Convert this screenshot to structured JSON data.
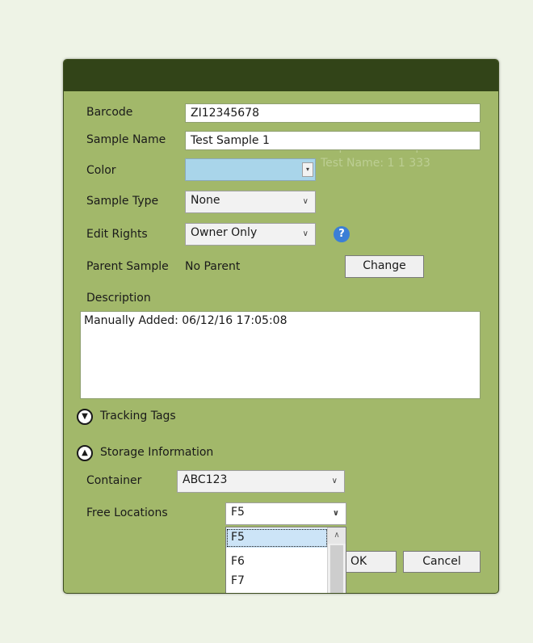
{
  "form": {
    "barcode_label": "Barcode",
    "barcode_value": "ZI12345678",
    "sample_name_label": "Sample Name",
    "sample_name_value": "Test Sample 1",
    "color_label": "Color",
    "color_value": "#a9d5ea",
    "sample_type_label": "Sample Type",
    "sample_type_value": "None",
    "edit_rights_label": "Edit Rights",
    "edit_rights_value": "Owner Only",
    "help_glyph": "?",
    "parent_sample_label": "Parent Sample",
    "parent_sample_value": "No Parent",
    "change_button": "Change",
    "description_label": "Description",
    "description_value": "Manually Added: 06/12/16 17:05:08"
  },
  "tracking": {
    "label": "Tracking Tags",
    "expanded": false
  },
  "storage": {
    "label": "Storage Information",
    "expanded": true,
    "container_label": "Container",
    "container_value": "ABC123",
    "free_locations_label": "Free Locations",
    "free_locations_value": "F5",
    "dropdown_options": [
      "F5",
      "F6",
      "F7"
    ],
    "dropdown_selected": "F5"
  },
  "buttons": {
    "ok": "OK",
    "cancel": "Cancel"
  },
  "background_ghost": {
    "lines": [
      "Emp Name: Sample First",
      "Test Name: 1 1 333"
    ]
  },
  "colors": {
    "title_bar": "#324418",
    "dialog_bg": "#a2b86a",
    "page_bg": "#eef3e6",
    "help_icon": "#3b7fd6"
  },
  "icons": {
    "combo_arrow": "chevron-down-icon",
    "help": "help-icon",
    "expander_collapsed": "chevron-down-circle-icon",
    "expander_expanded": "chevron-up-circle-icon"
  }
}
